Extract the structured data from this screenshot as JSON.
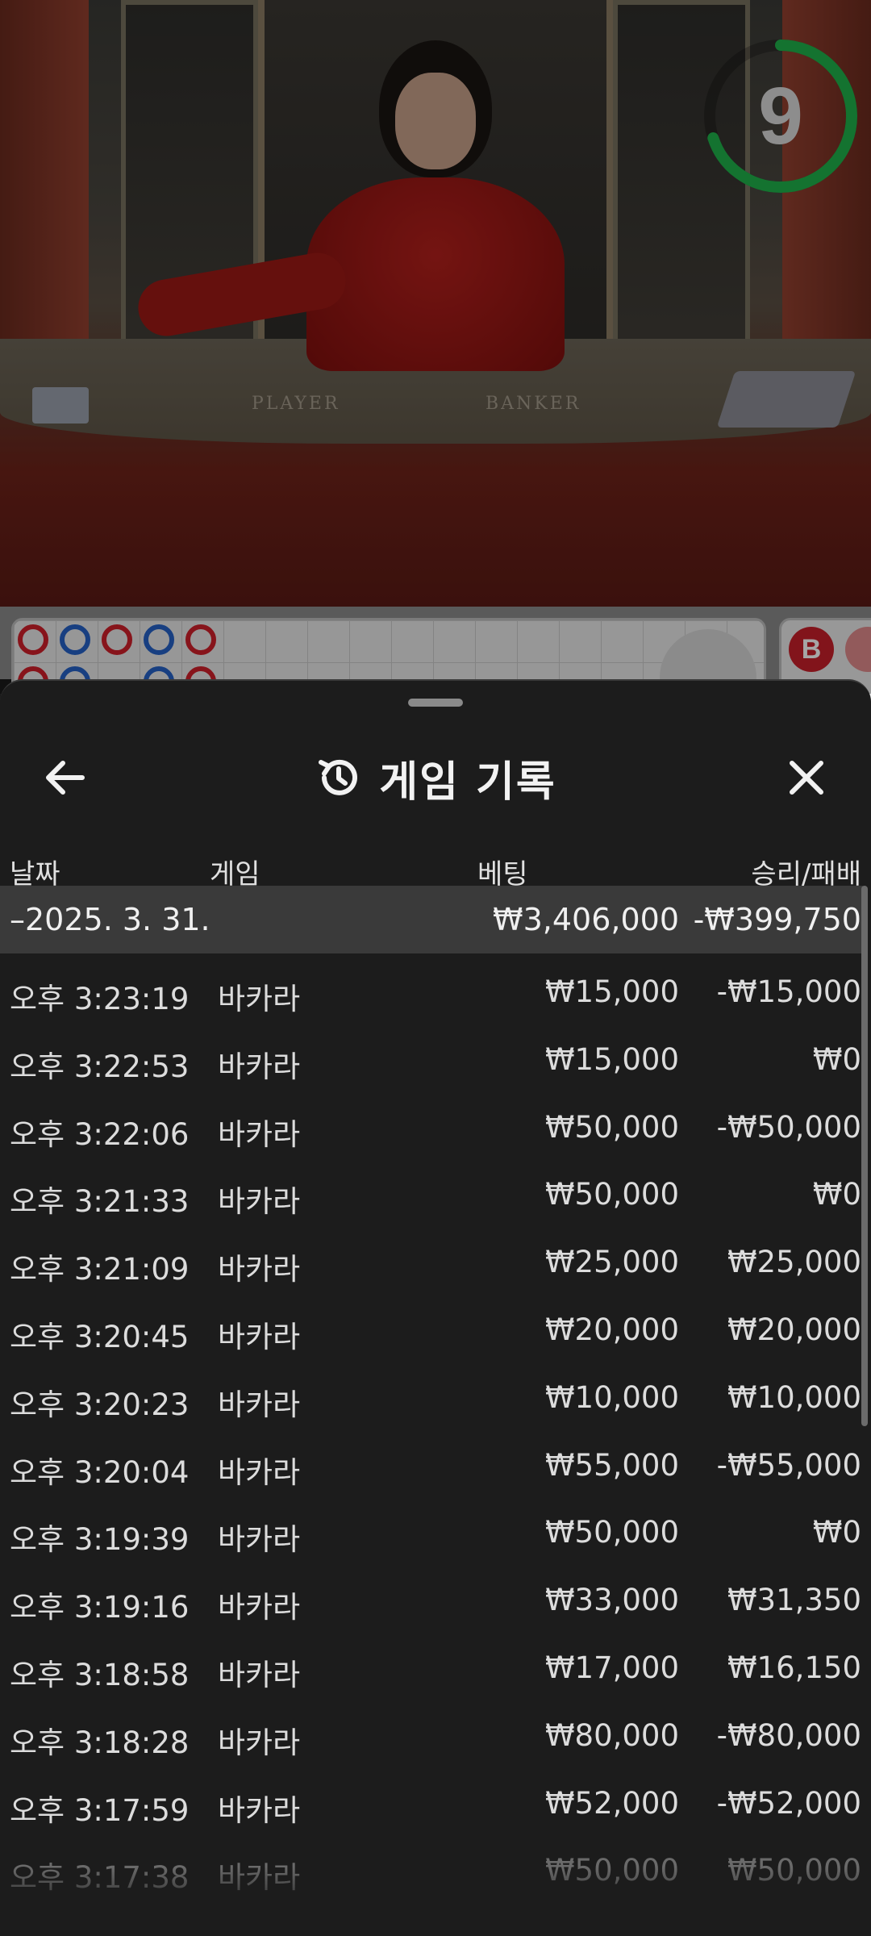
{
  "video": {
    "table_labels": {
      "player": "PLAYER",
      "banker": "BANKER"
    },
    "timer_value": "9",
    "timer_color": "#1fb14a",
    "timer_progress": 0.7
  },
  "roadmap": {
    "bead_label": "B",
    "colors": {
      "red": "#d0202a",
      "blue": "#2661c7"
    }
  },
  "sheet": {
    "title": "게임 기록",
    "icons": {
      "back": "arrow-left-icon",
      "history": "history-icon",
      "close": "close-icon"
    },
    "columns": {
      "date": "날짜",
      "game": "게임",
      "bet": "베팅",
      "win_loss": "승리/패배"
    },
    "summary": {
      "date": "–2025. 3. 31.",
      "bet": "₩3,406,000",
      "win_loss": "-₩399,750"
    },
    "rows": [
      {
        "time": "오후 3:23:19",
        "game": "바카라",
        "bet": "₩15,000",
        "win_loss": "-₩15,000"
      },
      {
        "time": "오후 3:22:53",
        "game": "바카라",
        "bet": "₩15,000",
        "win_loss": "₩0"
      },
      {
        "time": "오후 3:22:06",
        "game": "바카라",
        "bet": "₩50,000",
        "win_loss": "-₩50,000"
      },
      {
        "time": "오후 3:21:33",
        "game": "바카라",
        "bet": "₩50,000",
        "win_loss": "₩0"
      },
      {
        "time": "오후 3:21:09",
        "game": "바카라",
        "bet": "₩25,000",
        "win_loss": "₩25,000"
      },
      {
        "time": "오후 3:20:45",
        "game": "바카라",
        "bet": "₩20,000",
        "win_loss": "₩20,000"
      },
      {
        "time": "오후 3:20:23",
        "game": "바카라",
        "bet": "₩10,000",
        "win_loss": "₩10,000"
      },
      {
        "time": "오후 3:20:04",
        "game": "바카라",
        "bet": "₩55,000",
        "win_loss": "-₩55,000"
      },
      {
        "time": "오후 3:19:39",
        "game": "바카라",
        "bet": "₩50,000",
        "win_loss": "₩0"
      },
      {
        "time": "오후 3:19:16",
        "game": "바카라",
        "bet": "₩33,000",
        "win_loss": "₩31,350"
      },
      {
        "time": "오후 3:18:58",
        "game": "바카라",
        "bet": "₩17,000",
        "win_loss": "₩16,150"
      },
      {
        "time": "오후 3:18:28",
        "game": "바카라",
        "bet": "₩80,000",
        "win_loss": "-₩80,000"
      },
      {
        "time": "오후 3:17:59",
        "game": "바카라",
        "bet": "₩52,000",
        "win_loss": "-₩52,000"
      },
      {
        "time": "오후 3:17:38",
        "game": "바카라",
        "bet": "₩50,000",
        "win_loss": "₩50,000"
      }
    ]
  }
}
